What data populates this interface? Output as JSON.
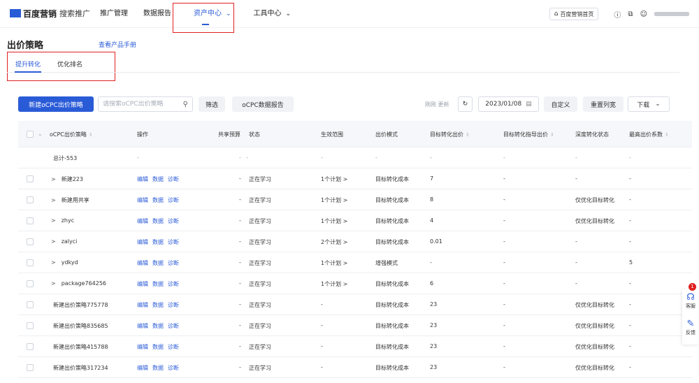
{
  "brand": {
    "name": "百度营销",
    "product": "搜索推广"
  },
  "nav": [
    "推广管理",
    "数据报告",
    "资产中心",
    "工具中心"
  ],
  "topright": {
    "home": "百度营销首页"
  },
  "page": {
    "title": "出价策略",
    "manual_link": "查看产品手册"
  },
  "subtabs": [
    "提升转化",
    "优化排名"
  ],
  "toolbar": {
    "create": "新建oCPC出价策略",
    "search_placeholder": "请搜索oCPC出价策略",
    "filter": "筛选",
    "report": "oCPC数据报告",
    "refresh_text": "刚刚 更新",
    "date": "2023/01/08",
    "custom": "自定义",
    "reset_columns": "重置列宽",
    "download": "下载"
  },
  "columns": [
    "oCPC出价策略",
    "操作",
    "共享预算",
    "状态",
    "生效范围",
    "出价模式",
    "目标转化出价",
    "目标转化指导出价",
    "深度转化状态",
    "最高出价系数"
  ],
  "ops": [
    "编辑",
    "数据",
    "诊断"
  ],
  "total_row": {
    "name": "总计-553",
    "dash": "-"
  },
  "rows": [
    {
      "name": "新建223",
      "expand": true,
      "budget": "-",
      "status": "正在学习",
      "scope": "1个计划 >",
      "mode": "目标转化成本",
      "target": "7",
      "guide": "-",
      "deep": "-",
      "coef": "-"
    },
    {
      "name": "新建用共享",
      "expand": true,
      "budget": "-",
      "status": "正在学习",
      "scope": "1个计划 >",
      "mode": "目标转化成本",
      "target": "8",
      "guide": "-",
      "deep": "仅优化目标转化",
      "coef": "-"
    },
    {
      "name": "zhyc",
      "expand": true,
      "budget": "-",
      "status": "正在学习",
      "scope": "1个计划 >",
      "mode": "目标转化成本",
      "target": "4",
      "guide": "-",
      "deep": "仅优化目标转化",
      "coef": "-"
    },
    {
      "name": "zalyci",
      "expand": true,
      "budget": "-",
      "status": "正在学习",
      "scope": "2个计划 >",
      "mode": "目标转化成本",
      "target": "0.01",
      "guide": "-",
      "deep": "-",
      "coef": "-"
    },
    {
      "name": "ydkyd",
      "expand": true,
      "budget": "-",
      "status": "正在学习",
      "scope": "1个计划 >",
      "mode": "增强模式",
      "target": "-",
      "guide": "-",
      "deep": "-",
      "coef": "5"
    },
    {
      "name": "package764256",
      "expand": true,
      "budget": "-",
      "status": "正在学习",
      "scope": "1个计划 >",
      "mode": "目标转化成本",
      "target": "6",
      "guide": "-",
      "deep": "-",
      "coef": "-"
    },
    {
      "name": "新建出价策略775778",
      "expand": false,
      "budget": "-",
      "status": "正在学习",
      "scope": "-",
      "mode": "目标转化成本",
      "target": "23",
      "guide": "-",
      "deep": "仅优化目标转化",
      "coef": "-"
    },
    {
      "name": "新建出价策略835685",
      "expand": false,
      "budget": "-",
      "status": "正在学习",
      "scope": "-",
      "mode": "目标转化成本",
      "target": "23",
      "guide": "-",
      "deep": "仅优化目标转化",
      "coef": "-"
    },
    {
      "name": "新建出价策略415788",
      "expand": false,
      "budget": "-",
      "status": "正在学习",
      "scope": "-",
      "mode": "目标转化成本",
      "target": "23",
      "guide": "-",
      "deep": "仅优化目标转化",
      "coef": "-"
    },
    {
      "name": "新建出价策略317234",
      "expand": false,
      "budget": "-",
      "status": "正在学习",
      "scope": "-",
      "mode": "目标转化成本",
      "target": "23",
      "guide": "-",
      "deep": "仅优化目标转化",
      "coef": "-"
    }
  ],
  "float": {
    "service": "客服",
    "feedback": "反馈",
    "badge": "1"
  },
  "colors": {
    "accent": "#2a5bd7",
    "highlight": "#e02020"
  }
}
